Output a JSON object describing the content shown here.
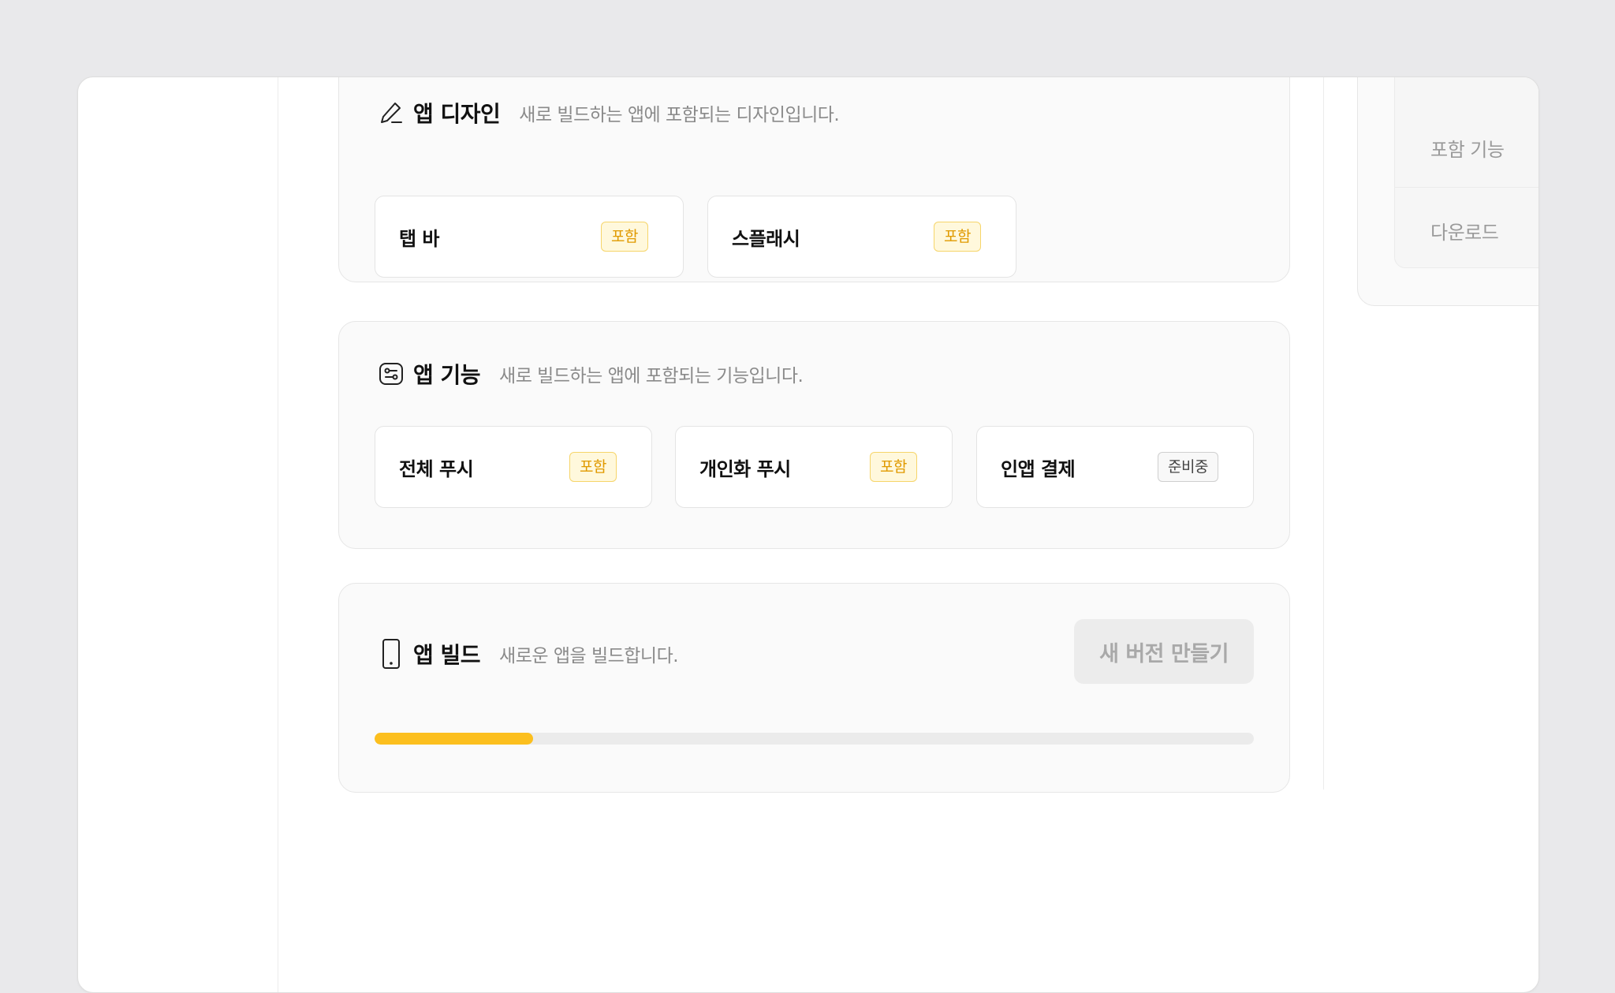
{
  "design": {
    "title": "앱 디자인",
    "description": "새로 빌드하는 앱에 포함되는 디자인입니다.",
    "icon": "pen-icon",
    "items": [
      {
        "label": "탭 바",
        "badge": "포함",
        "status": "included"
      },
      {
        "label": "스플래시",
        "badge": "포함",
        "status": "included"
      }
    ]
  },
  "features": {
    "title": "앱 기능",
    "description": "새로 빌드하는 앱에 포함되는 기능입니다.",
    "icon": "settings-toggle-icon",
    "items": [
      {
        "label": "전체 푸시",
        "badge": "포함",
        "status": "included"
      },
      {
        "label": "개인화 푸시",
        "badge": "포함",
        "status": "included"
      },
      {
        "label": "인앱 결제",
        "badge": "준비중",
        "status": "pending"
      }
    ]
  },
  "build": {
    "title": "앱 빌드",
    "description": "새로운 앱을 빌드합니다.",
    "icon": "phone-icon",
    "button_label": "새 버전 만들기",
    "progress_percent": 18
  },
  "side_nav": {
    "items": [
      {
        "label": "포함 기능"
      },
      {
        "label": "다운로드"
      }
    ]
  },
  "colors": {
    "accent": "#fcbf1e",
    "included_text": "#e09a00",
    "included_bg": "#fff8dc"
  }
}
